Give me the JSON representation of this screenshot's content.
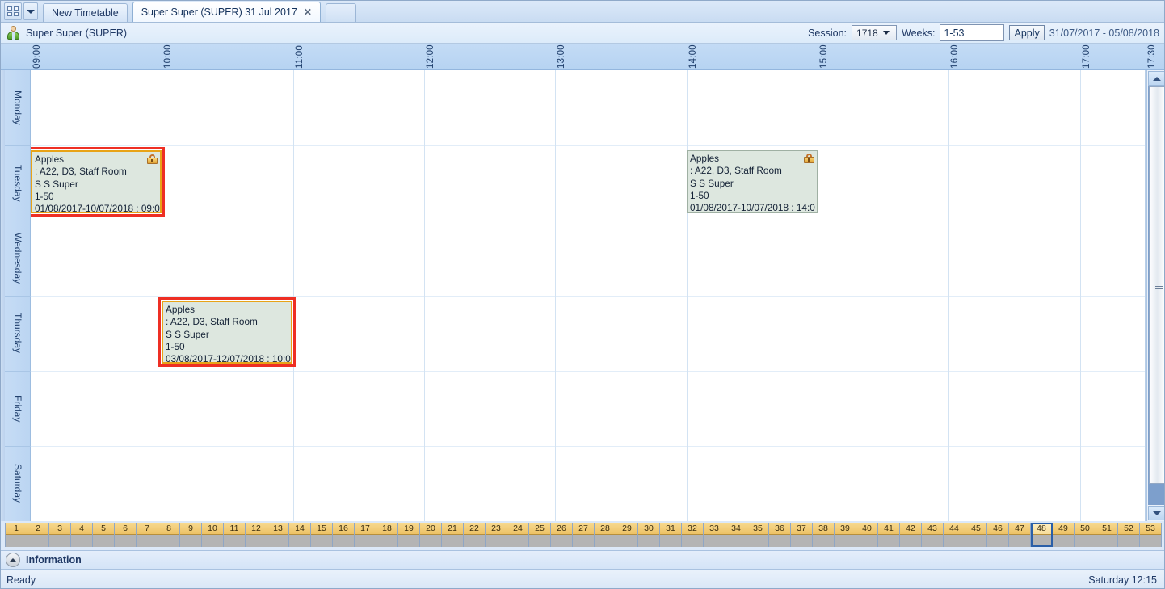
{
  "window": {
    "toolbar": {
      "grid_icon": "grid-view-icon",
      "dropdown_icon": "chevron-down-icon"
    },
    "tabs": [
      {
        "label": "New Timetable",
        "active": false,
        "closable": false
      },
      {
        "label": "Super Super (SUPER) 31 Jul 2017",
        "active": true,
        "closable": true,
        "close_label": "✕"
      }
    ]
  },
  "header": {
    "avatar_icon": "person-icon",
    "title": "Super Super (SUPER)",
    "session_label": "Session:",
    "session_value": "1718",
    "weeks_label": "Weeks:",
    "weeks_value": "1-53",
    "apply_label": "Apply",
    "date_range": "31/07/2017  -  05/08/2018"
  },
  "timeaxis": {
    "labels": [
      "09:00",
      "10:00",
      "11:00",
      "12:00",
      "13:00",
      "14:00",
      "15:00",
      "16:00",
      "17:00",
      "17:30"
    ],
    "start": "09:00",
    "end": "17:30"
  },
  "days": [
    "Monday",
    "Tuesday",
    "Wednesday",
    "Thursday",
    "Friday",
    "Saturday"
  ],
  "events": [
    {
      "id": "ev-tue-morning",
      "title": "Apples",
      "room": ": A22, D3, Staff Room",
      "teacher": "S S Super",
      "weeks": "1-50",
      "daterange": "01/08/2017-10/07/2018 : 09:0",
      "day": "Tuesday",
      "start": "09:00",
      "selected": true,
      "focused": true,
      "locked": true,
      "lock_icon": "padlock-icon"
    },
    {
      "id": "ev-tue-afternoon",
      "title": "Apples",
      "room": ": A22, D3, Staff Room",
      "teacher": "S S Super",
      "weeks": "1-50",
      "daterange": "01/08/2017-10/07/2018 : 14:0",
      "day": "Tuesday",
      "start": "14:00",
      "selected": false,
      "focused": false,
      "locked": true,
      "lock_icon": "padlock-icon"
    },
    {
      "id": "ev-thu-morning",
      "title": "Apples",
      "room": ": A22, D3, Staff Room",
      "teacher": "S S Super",
      "weeks": "1-50",
      "daterange": "03/08/2017-12/07/2018 : 10:0",
      "day": "Thursday",
      "start": "10:00",
      "selected": true,
      "focused": true,
      "locked": false,
      "lock_icon": null
    }
  ],
  "weekstrip": {
    "weeks": [
      1,
      2,
      3,
      4,
      5,
      6,
      7,
      8,
      9,
      10,
      11,
      12,
      13,
      14,
      15,
      16,
      17,
      18,
      19,
      20,
      21,
      22,
      23,
      24,
      25,
      26,
      27,
      28,
      29,
      30,
      31,
      32,
      33,
      34,
      35,
      36,
      37,
      38,
      39,
      40,
      41,
      42,
      43,
      44,
      45,
      46,
      47,
      48,
      49,
      50,
      51,
      52,
      53
    ],
    "current": 48
  },
  "information": {
    "collapse_icon": "chevron-up-icon",
    "title": "Information"
  },
  "status": {
    "left": "Ready",
    "right": "Saturday 12:15"
  },
  "scrollbar": {
    "up_icon": "scroll-up-arrow-icon",
    "down_icon": "scroll-down-arrow-icon",
    "grip_icon": "scrollbar-grip-icon"
  },
  "colors": {
    "accent": "#2a5fa8",
    "selection": "#ee2f24",
    "focus": "#e8a317",
    "event_bg": "#dde7df",
    "week_header": "#edc265"
  }
}
